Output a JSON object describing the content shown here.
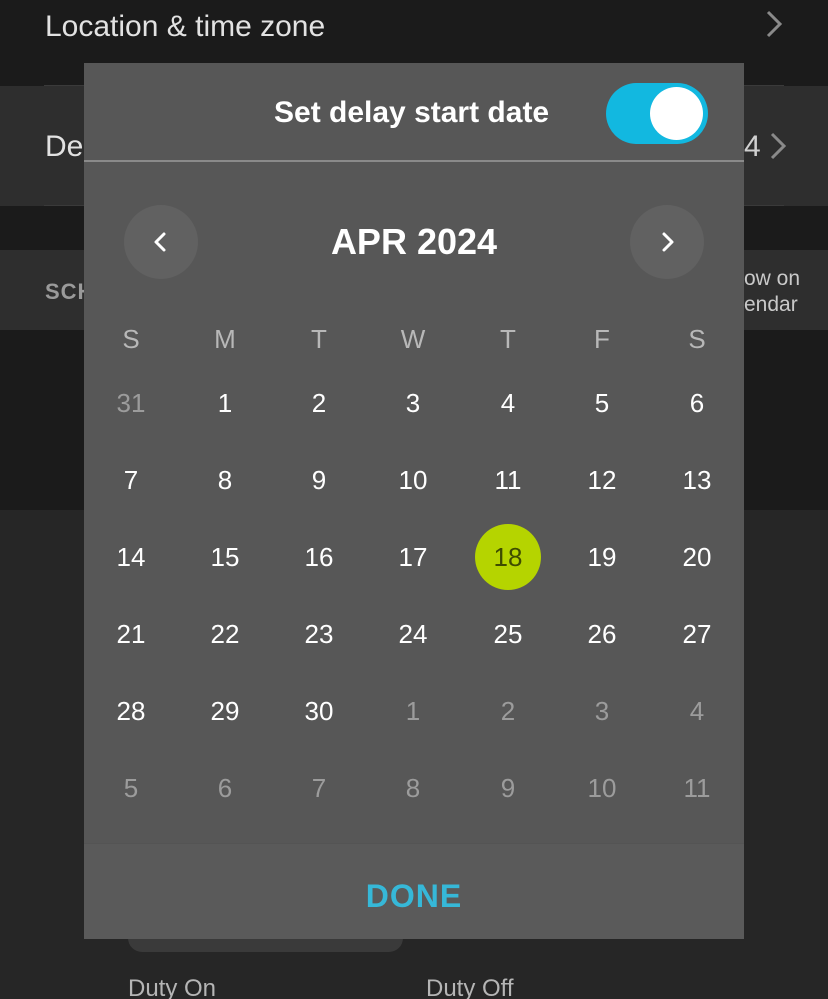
{
  "background": {
    "location_label": "Location & time zone",
    "delay_label": "De",
    "delay_value": "4",
    "schedule_label": "SCH",
    "show_on_calendar": [
      "ow on",
      "endar"
    ],
    "duty_on_label": "Duty On",
    "duty_off_label": "Duty Off"
  },
  "dialog": {
    "title": "Set delay start date",
    "toggle_on": true,
    "month_label": "APR 2024",
    "weekdays": [
      "S",
      "M",
      "T",
      "W",
      "T",
      "F",
      "S"
    ],
    "weeks": [
      [
        {
          "d": "31",
          "m": true
        },
        {
          "d": "1"
        },
        {
          "d": "2"
        },
        {
          "d": "3"
        },
        {
          "d": "4"
        },
        {
          "d": "5"
        },
        {
          "d": "6"
        }
      ],
      [
        {
          "d": "7"
        },
        {
          "d": "8"
        },
        {
          "d": "9"
        },
        {
          "d": "10"
        },
        {
          "d": "11"
        },
        {
          "d": "12"
        },
        {
          "d": "13"
        }
      ],
      [
        {
          "d": "14"
        },
        {
          "d": "15"
        },
        {
          "d": "16"
        },
        {
          "d": "17"
        },
        {
          "d": "18",
          "s": true
        },
        {
          "d": "19"
        },
        {
          "d": "20"
        }
      ],
      [
        {
          "d": "21"
        },
        {
          "d": "22"
        },
        {
          "d": "23"
        },
        {
          "d": "24"
        },
        {
          "d": "25"
        },
        {
          "d": "26"
        },
        {
          "d": "27"
        }
      ],
      [
        {
          "d": "28"
        },
        {
          "d": "29"
        },
        {
          "d": "30"
        },
        {
          "d": "1",
          "m": true
        },
        {
          "d": "2",
          "m": true
        },
        {
          "d": "3",
          "m": true
        },
        {
          "d": "4",
          "m": true
        }
      ],
      [
        {
          "d": "5",
          "m": true
        },
        {
          "d": "6",
          "m": true
        },
        {
          "d": "7",
          "m": true
        },
        {
          "d": "8",
          "m": true
        },
        {
          "d": "9",
          "m": true
        },
        {
          "d": "10",
          "m": true
        },
        {
          "d": "11",
          "m": true
        }
      ]
    ],
    "selected_date": "18",
    "done_label": "DONE",
    "colors": {
      "toggle": "#12b8e0",
      "selected": "#b5d400",
      "done": "#36b8d8"
    },
    "icons": {
      "prev": "chevron-left-icon",
      "next": "chevron-right-icon"
    }
  }
}
